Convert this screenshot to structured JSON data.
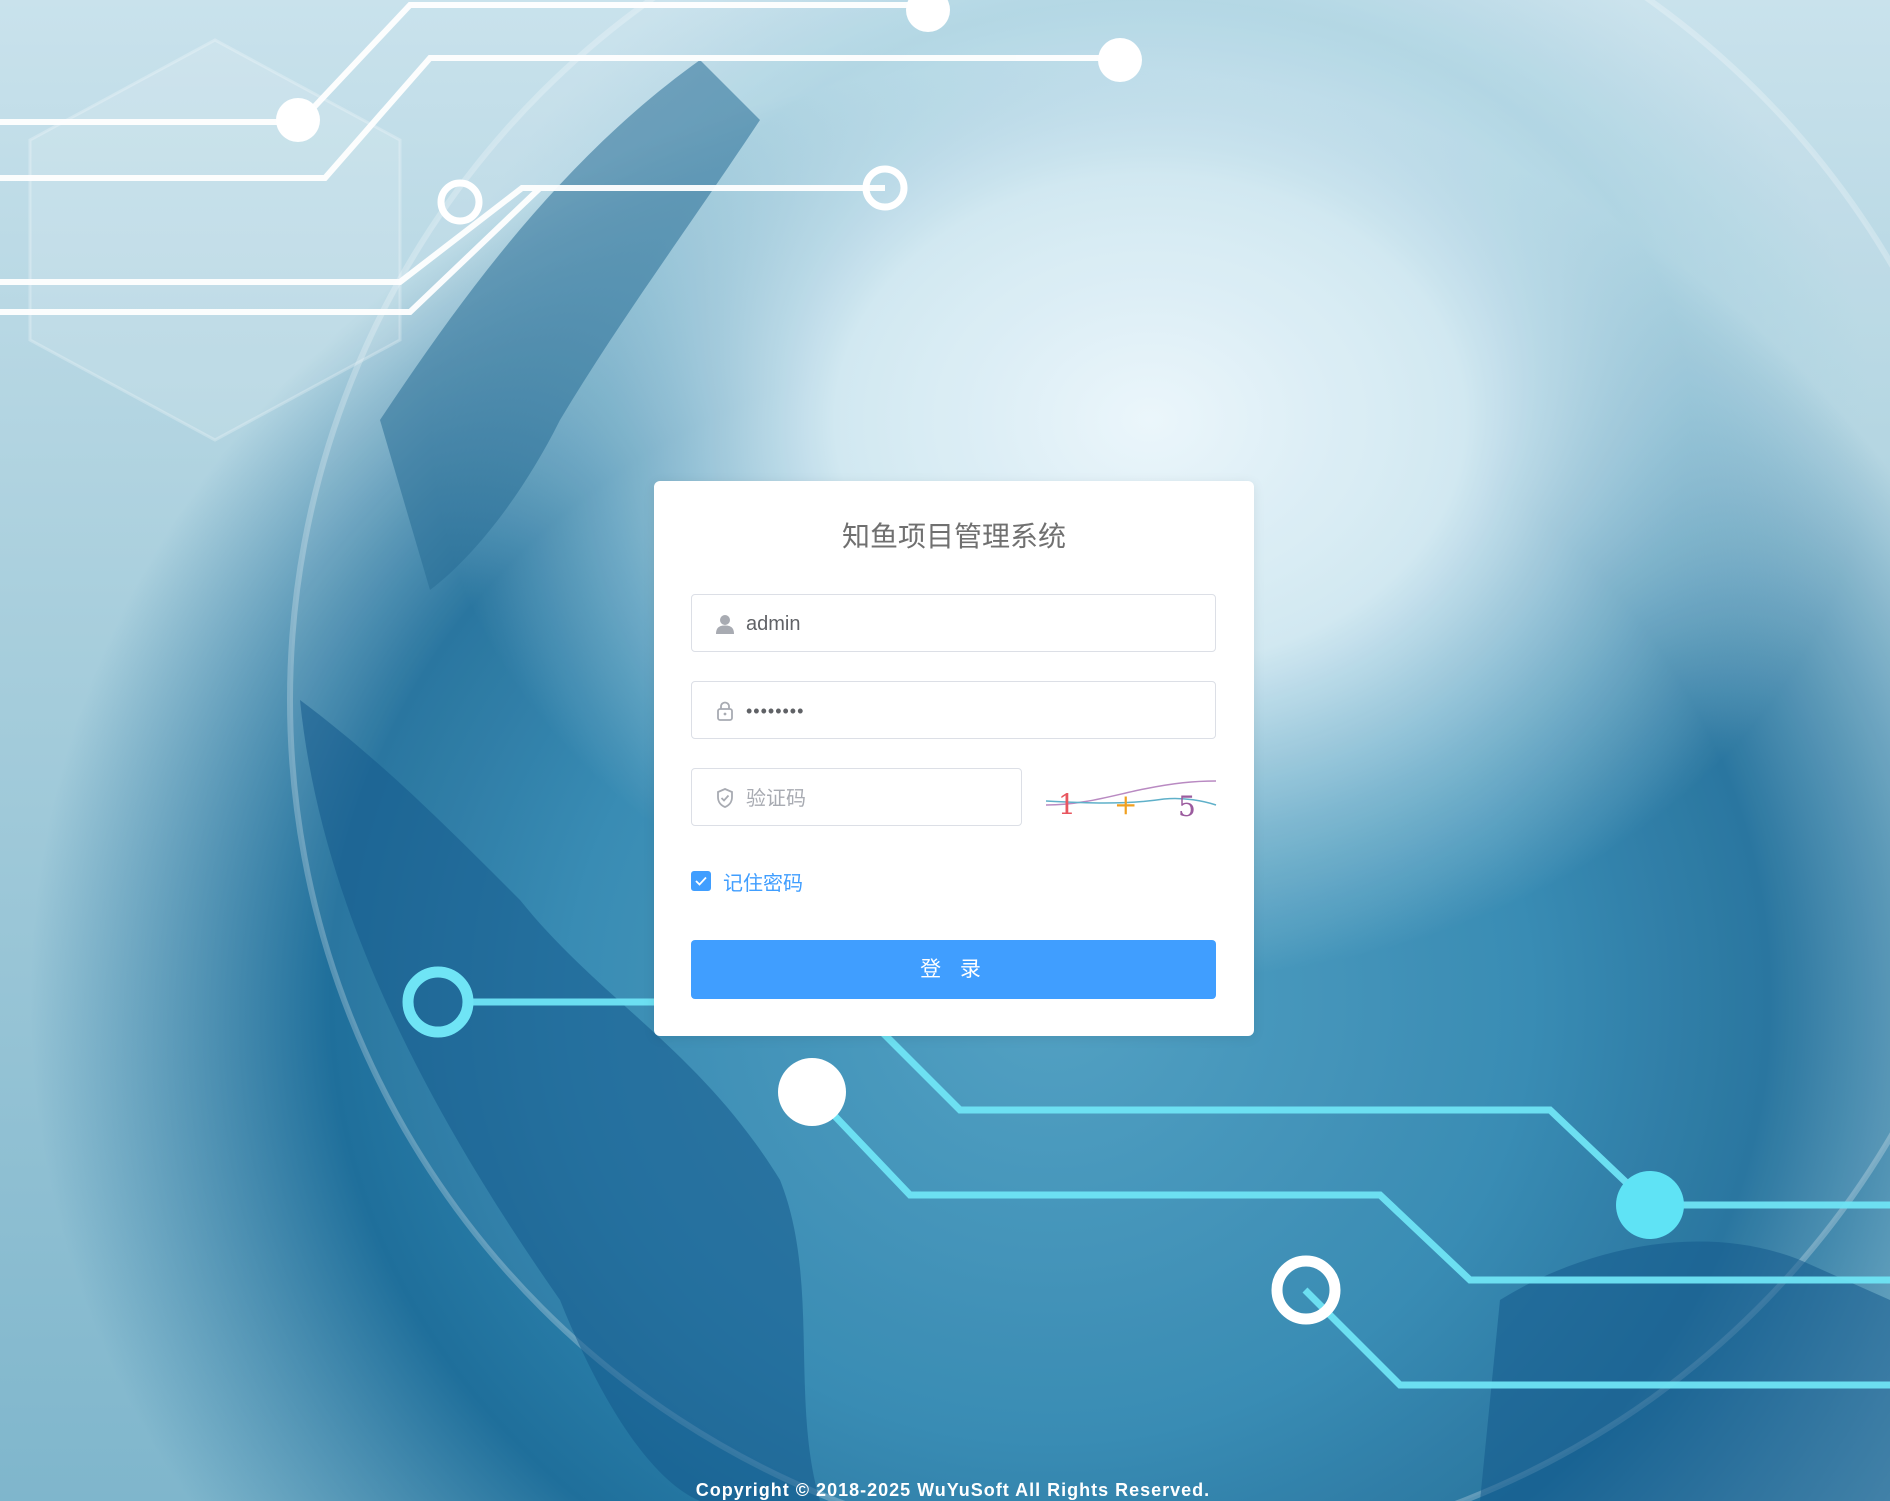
{
  "app": {
    "title": "知鱼项目管理系统"
  },
  "form": {
    "username_value": "admin",
    "password_value": "••••••••",
    "captcha_placeholder": "验证码",
    "captcha_image": {
      "chars": [
        "1",
        "+",
        "5"
      ],
      "colors": [
        "#e8565f",
        "#f0a020",
        "#9b5b9e"
      ]
    },
    "remember_label": "记住密码",
    "remember_checked": true,
    "login_label": "登 录"
  },
  "footer": {
    "copyright": "Copyright © 2018-2025 WuYuSoft All Rights Reserved."
  },
  "colors": {
    "primary": "#409eff",
    "title": "#707070",
    "input_border": "#dcdfe6"
  }
}
